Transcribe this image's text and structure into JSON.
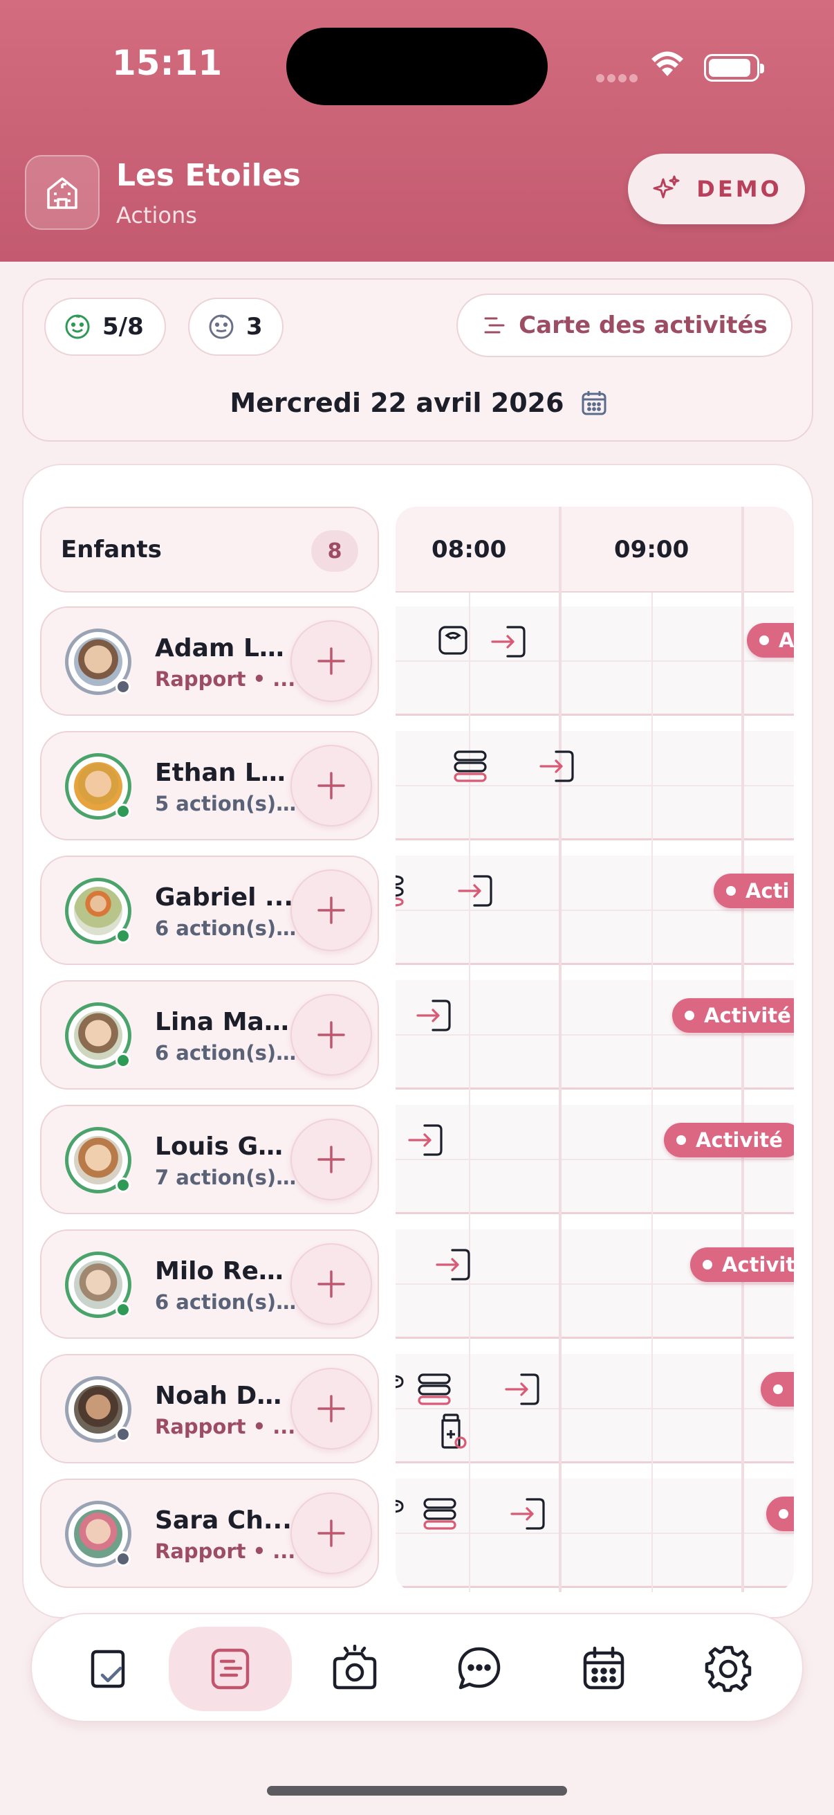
{
  "status": {
    "time": "15:11"
  },
  "header": {
    "school_name": "Les Etoiles",
    "subtitle": "Actions",
    "demo_label": "DEMO",
    "icons": {
      "school": "school-building-icon",
      "demo": "sparkles-icon"
    }
  },
  "summary": {
    "present_count": "5/8",
    "absent_count": "3",
    "activity_map_label": "Carte des activités",
    "date_label": "Mercredi 22 avril 2026"
  },
  "children_panel": {
    "title": "Enfants",
    "count": "8",
    "children": [
      {
        "name": "Adam La...",
        "subtitle": "Rapport • ...",
        "present": false
      },
      {
        "name": "Ethan Le...",
        "subtitle": "5 action(s)...",
        "present": true
      },
      {
        "name": "Gabriel ...",
        "subtitle": "6 action(s)...",
        "present": true
      },
      {
        "name": "Lina Mar...",
        "subtitle": "6 action(s)...",
        "present": true
      },
      {
        "name": "Louis Ga...",
        "subtitle": "7 action(s)...",
        "present": true
      },
      {
        "name": "Milo Ren...",
        "subtitle": "6 action(s)...",
        "present": true
      },
      {
        "name": "Noah Du...",
        "subtitle": "Rapport • ...",
        "present": false
      },
      {
        "name": "Sara Ch...",
        "subtitle": "Rapport • ...",
        "present": false
      }
    ]
  },
  "timeline": {
    "hours": [
      "08:00",
      "09:00"
    ],
    "badges": [
      "A",
      "Acti",
      "Activité",
      "Activité",
      "Activit"
    ]
  },
  "nav": {
    "items": [
      "checklist-icon",
      "timeline-icon",
      "camera-icon",
      "chat-icon",
      "calendar-icon",
      "settings-icon"
    ],
    "active_index": 1
  },
  "colors": {
    "accent": "#c35a70",
    "badge": "#dc6783",
    "present": "#2e9a56",
    "absent": "#5b6275"
  }
}
